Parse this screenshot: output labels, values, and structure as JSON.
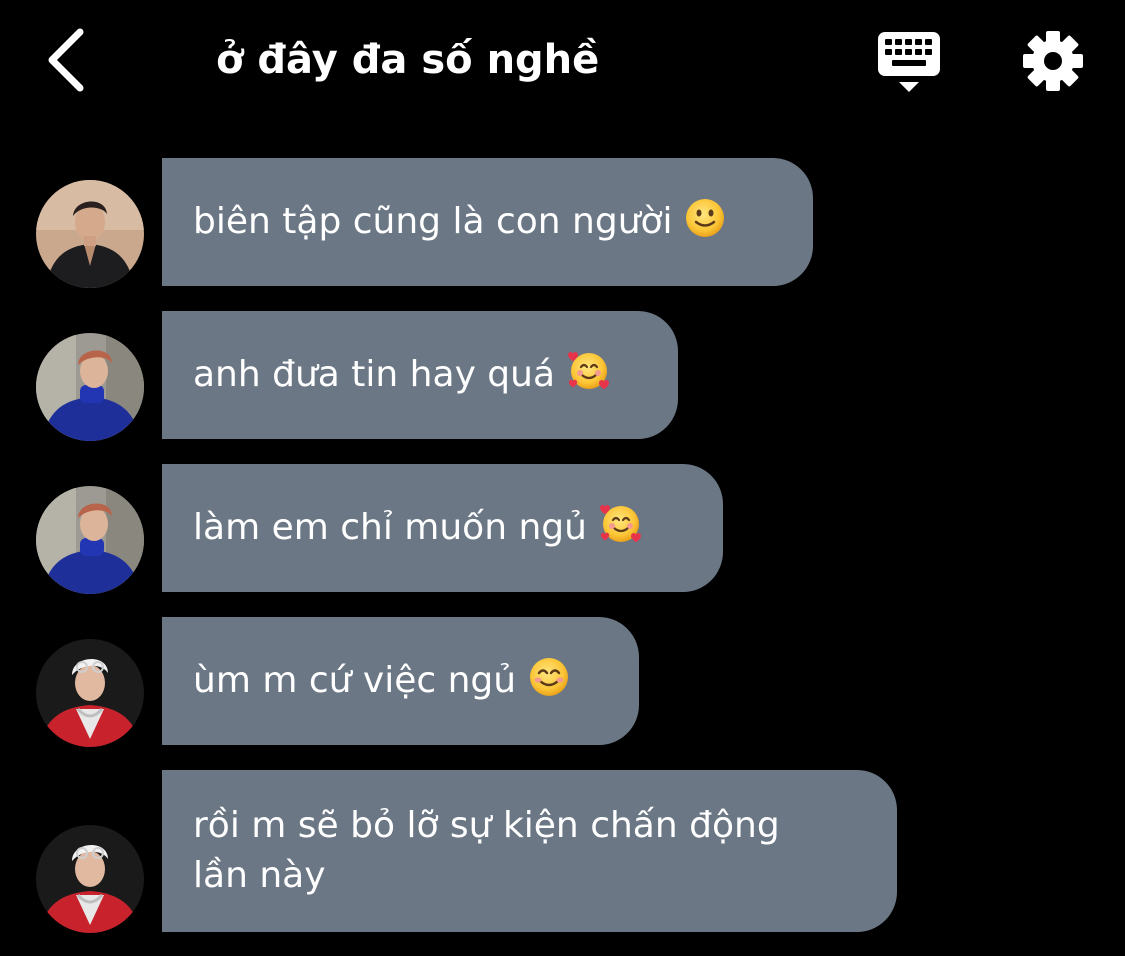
{
  "header": {
    "title": "ở đây đa số nghề",
    "back_icon": "chevron-left-icon",
    "keyboard_icon": "keyboard-icon",
    "settings_icon": "gear-icon"
  },
  "messages": [
    {
      "text": "biên tập cũng là con người",
      "emoji": "slightly-smiling-face",
      "avatar": "avatar-black-suit"
    },
    {
      "text": "anh đưa tin hay quá",
      "emoji": "smiling-face-with-hearts",
      "avatar": "avatar-blue-turtleneck"
    },
    {
      "text": "làm em chỉ muốn ngủ",
      "emoji": "smiling-face-with-hearts",
      "avatar": "avatar-blue-turtleneck"
    },
    {
      "text": "ùm m cứ việc ngủ",
      "emoji": "smiling-face-with-smiling-eyes",
      "avatar": "avatar-red-jacket"
    },
    {
      "text": "rồi m sẽ bỏ lỡ sự kiện chấn động\nlần này",
      "emoji": "",
      "avatar": "avatar-red-jacket"
    }
  ],
  "colors": {
    "background": "#000000",
    "bubble": "#6b7785",
    "text": "#ffffff"
  }
}
